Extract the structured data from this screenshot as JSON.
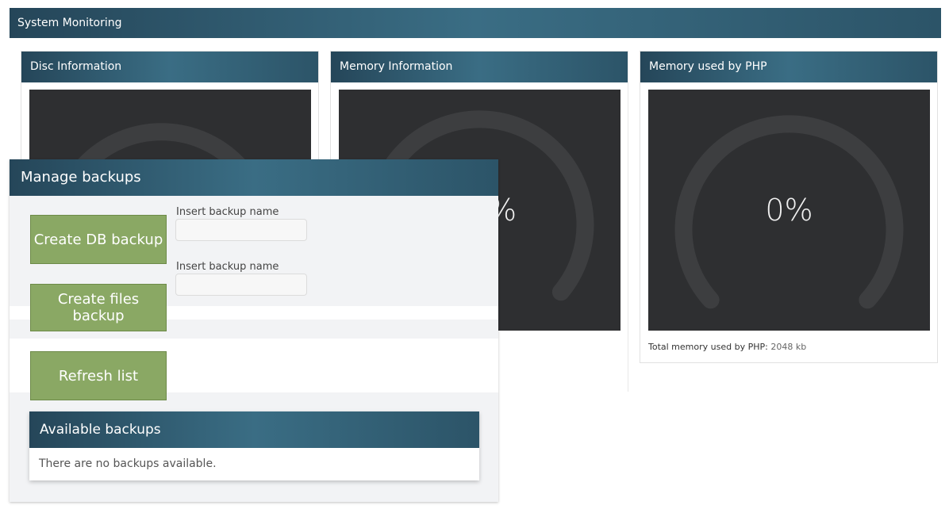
{
  "header": {
    "title": "System Monitoring"
  },
  "panels": {
    "disc": {
      "title": "Disc Information"
    },
    "memory": {
      "title": "Memory Information",
      "value_label": "%",
      "progress_percent": 22
    },
    "php": {
      "title": "Memory used by PHP",
      "value_label": "0%",
      "progress_percent": 0,
      "footer_label": "Total memory used by PHP:",
      "footer_value": "2048 kb"
    }
  },
  "manage_backups": {
    "title": "Manage backups",
    "create_db_label": "Create DB backup",
    "create_files_label": "Create files backup",
    "refresh_label": "Refresh list",
    "db_name_label": "Insert backup name",
    "files_name_label": "Insert backup name",
    "db_name_value": "",
    "files_name_value": ""
  },
  "available_backups": {
    "title": "Available backups",
    "empty_message": "There are no backups available."
  },
  "colors": {
    "header_gradient_start": "#254659",
    "header_gradient_mid": "#3a6d84",
    "gauge_track": "#3d3e40",
    "gauge_fill": "#2176b8",
    "button_green": "#8aa864"
  }
}
